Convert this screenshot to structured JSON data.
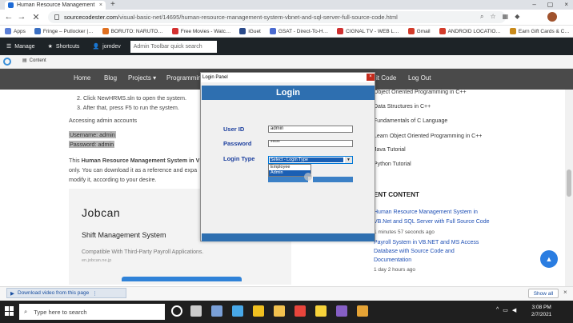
{
  "browser": {
    "tab_title": "Human Resource Management S",
    "tab_close": "×",
    "new_tab": "+",
    "window_controls": [
      "–",
      "▢",
      "×"
    ],
    "url_host": "sourcecodester.com",
    "url_path": "/visual-basic-net/14695/human-resource-management-system-vbnet-and-sql-server-full-source-code.html",
    "bookmarks": [
      {
        "label": "Apps",
        "color": "#5b7fd6"
      },
      {
        "label": "Fringe – Putlocker |…",
        "color": "#3a6fc2"
      },
      {
        "label": "BORUTO: NARUTO…",
        "color": "#e07020"
      },
      {
        "label": "Free Movies - Watc…",
        "color": "#d43030"
      },
      {
        "label": "iGuet",
        "color": "#2a4a8a"
      },
      {
        "label": "GSAT - Direct-To-H…",
        "color": "#4a6ad0"
      },
      {
        "label": "CIGNAL TV - WEB L…",
        "color": "#d03030"
      },
      {
        "label": "Gmail",
        "color": "#d33b2a"
      },
      {
        "label": "ANDROID LOCATIO…",
        "color": "#d33b2a"
      },
      {
        "label": "Earn Gift Cards & C…",
        "color": "#c98a1a"
      }
    ]
  },
  "wpbar": {
    "manage": "Manage",
    "shortcuts": "Shortcuts",
    "user": "jomdev",
    "search_placeholder": "Admin Toolbar quick search",
    "content_tab": "Content"
  },
  "sitenav": {
    "items": [
      "Home",
      "Blog",
      "Projects ▾",
      "Programming"
    ],
    "right_items": [
      "it Code",
      "Log Out"
    ]
  },
  "content": {
    "steps": [
      "2.  Click NewHRMS.sln to open the system.",
      "3.  After that, press F5 to run the system."
    ],
    "access": "Accessing admin accounts",
    "username": "Username: admin",
    "password": "Password: admin",
    "para_pre": "This ",
    "para_bold": "Human Resource Management System in V",
    "para_line2": "only. You can download it as a reference and expa",
    "para_line3": "modify it, according to your desire.",
    "ad_brand": "Jobcan",
    "ad_sub": "Shift Management System",
    "ad_compat": "Compatible With Third-Party Payroll Applications.",
    "ad_site": "en.jobcan.ne.jp"
  },
  "sidebar": {
    "links": [
      "Object Oriented Programming in C++",
      "Data Structures in C++",
      "Fundamentals of C Language",
      "Learn Object Oriented Programming in C++",
      "Java Tutorial",
      "Python Tutorial"
    ],
    "recent_heading": "ENT CONTENT",
    "recent": [
      {
        "line1": "Human Resource Management System in",
        "line2": "VB.Net and SQL Server with Full Source Code",
        "meta": "1 minutes 57 seconds ago"
      },
      {
        "line1": "Payroll System in VB.NET and MS Access",
        "line2": "Database with Source Code and",
        "line3": "Documentation",
        "meta": "1 day 2 hours ago"
      }
    ]
  },
  "dialog": {
    "window_title": "Login Panel",
    "close": "×",
    "header": "Login",
    "user_label": "User ID",
    "user_value": "admin",
    "pass_label": "Password",
    "pass_value": "*****",
    "type_label": "Login Type",
    "type_selected": "Select - Login Type",
    "type_options": [
      "Employee",
      "Admin"
    ]
  },
  "download": {
    "chip": "Download video from this page",
    "show_all": "Show all",
    "close": "×"
  },
  "taskbar": {
    "search_placeholder": "Type here to search",
    "time": "3:08 PM",
    "date": "2/7/2021",
    "apps": [
      {
        "icon": "cortana-icon",
        "color": "#ffffff"
      },
      {
        "icon": "task-view-icon",
        "color": "#cccccc"
      },
      {
        "icon": "file-explorer-icon",
        "color": "#7aa0d8"
      },
      {
        "icon": "cloud-app-icon",
        "color": "#48a8e8"
      },
      {
        "icon": "sticky-app-icon",
        "color": "#f0c020"
      },
      {
        "icon": "folder-icon",
        "color": "#f2c14e"
      },
      {
        "icon": "chrome-icon",
        "color": "#e8453c"
      },
      {
        "icon": "notes-icon",
        "color": "#f7d33a"
      },
      {
        "icon": "visual-studio-icon",
        "color": "#865fc5"
      },
      {
        "icon": "vb-app-icon",
        "color": "#e5a335"
      }
    ]
  }
}
